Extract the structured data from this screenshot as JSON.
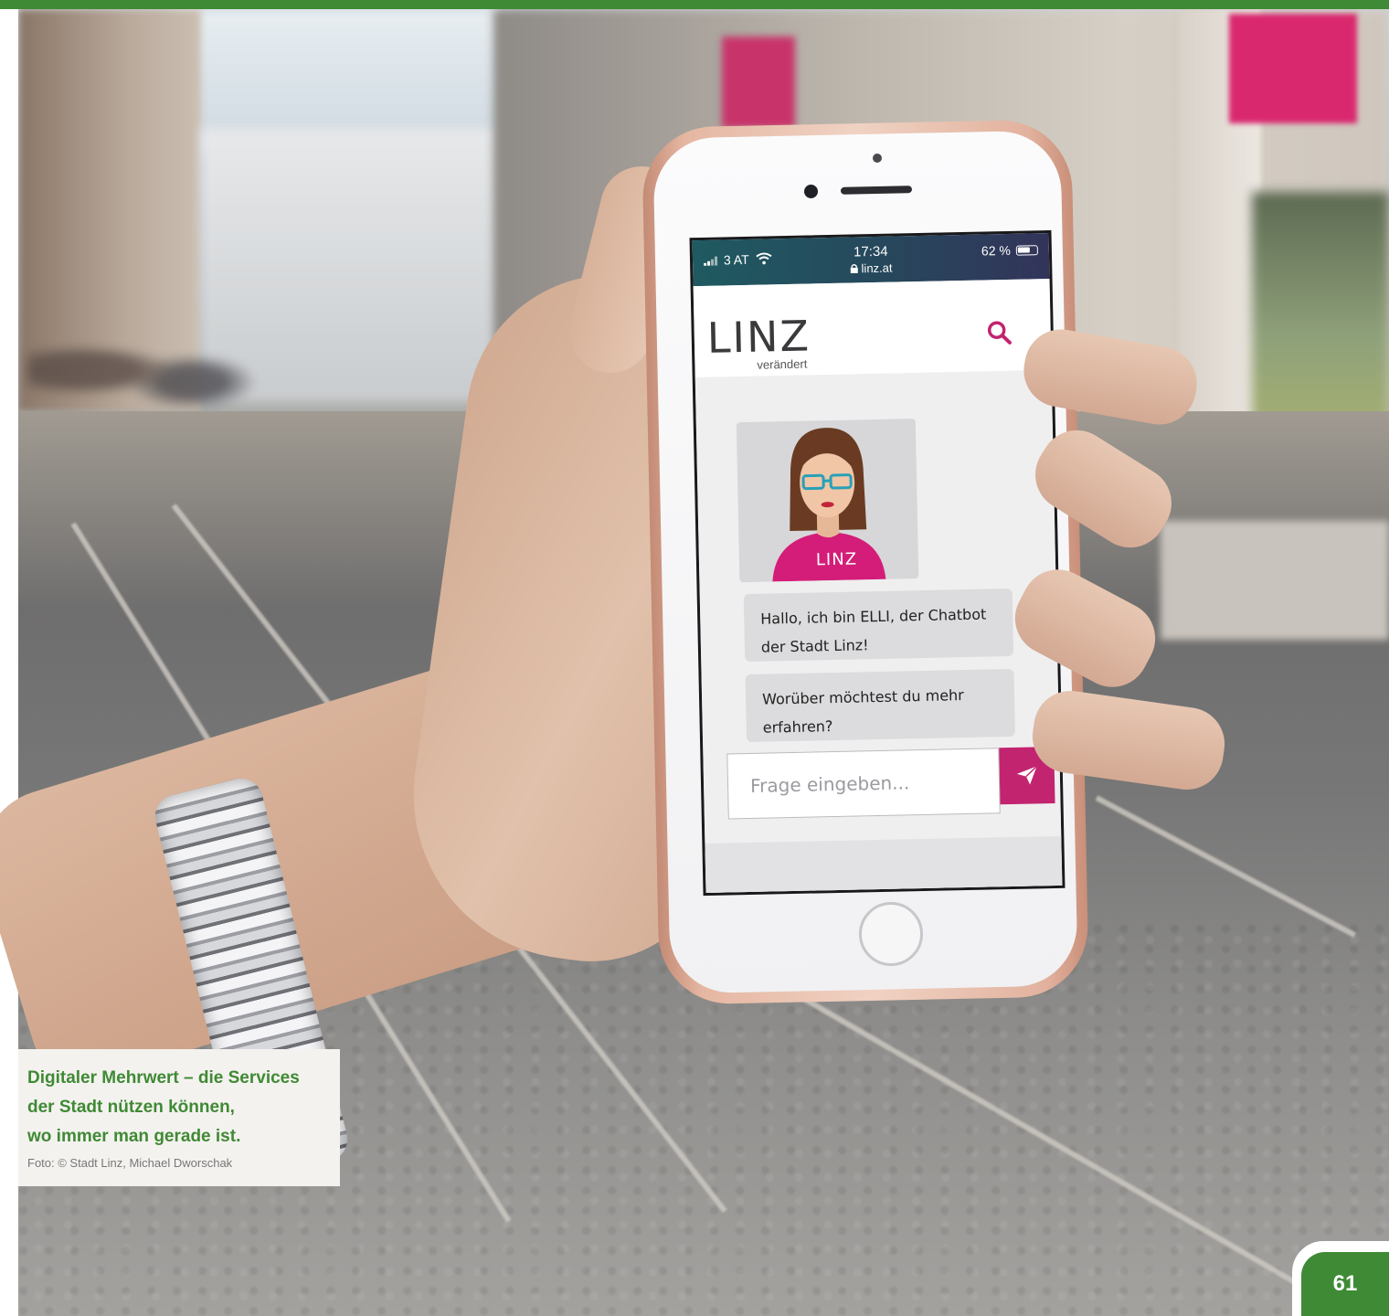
{
  "colors": {
    "accent_green": "#3f8a34",
    "brand_magenta": "#c2246f",
    "status_gradient": [
      "#1f5a61",
      "#33345a"
    ]
  },
  "phone": {
    "statusbar": {
      "carrier": "3 AT",
      "time": "17:34",
      "url": "linz.at",
      "battery": "62 %",
      "icons": [
        "signal-icon",
        "wifi-icon",
        "lock-icon",
        "battery-icon"
      ]
    },
    "site": {
      "logo_word": "LINZ",
      "logo_sub": "verändert",
      "search_icon": "search-icon"
    },
    "chat": {
      "avatar_badge": "LINZ",
      "messages": [
        "Hallo, ich bin ELLI, der Chatbot der Stadt Linz!",
        "Worüber möchtest du mehr erfahren?"
      ],
      "input_placeholder": "Frage eingeben...",
      "send_icon": "send-icon"
    }
  },
  "caption": {
    "lines": [
      "Digitaler Mehrwert – die Services",
      "der Stadt nützen können,",
      "wo immer man gerade ist."
    ],
    "credit": "Foto: © Stadt Linz, Michael Dworschak"
  },
  "page_number": "61"
}
